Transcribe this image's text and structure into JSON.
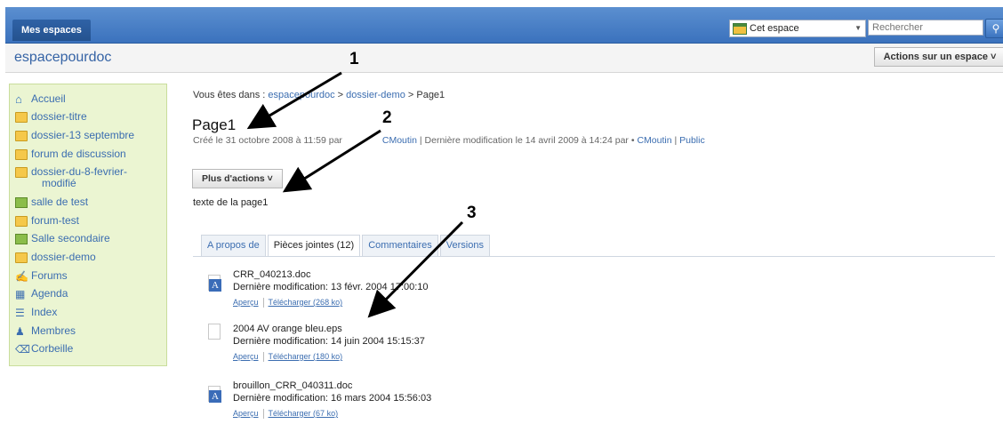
{
  "topbar": {
    "mes_espaces": "Mes espaces",
    "scope_label": "Cet espace",
    "search_placeholder": "Rechercher"
  },
  "space": {
    "title": "espacepourdoc",
    "actions_label": "Actions sur un espace ˅"
  },
  "sidebar": {
    "items": [
      {
        "label": "Accueil",
        "icon": "home-icon"
      },
      {
        "label": "dossier-titre",
        "icon": "folder-icon"
      },
      {
        "label": "dossier-13 septembre",
        "icon": "folder-icon"
      },
      {
        "label": "forum de discussion",
        "icon": "folder-icon"
      },
      {
        "label": "dossier-du-8-fevrier-",
        "label2": "modifié",
        "icon": "folder-icon"
      },
      {
        "label": "salle de test",
        "icon": "room-icon"
      },
      {
        "label": "forum-test",
        "icon": "folder-icon"
      },
      {
        "label": "Salle secondaire",
        "icon": "room-icon"
      },
      {
        "label": "dossier-demo",
        "icon": "folder-icon"
      },
      {
        "label": "Forums",
        "icon": "forum-icon"
      },
      {
        "label": "Agenda",
        "icon": "calendar-icon"
      },
      {
        "label": "Index",
        "icon": "index-icon"
      },
      {
        "label": "Membres",
        "icon": "members-icon"
      },
      {
        "label": "Corbeille",
        "icon": "trash-icon"
      }
    ]
  },
  "breadcrumb": {
    "prefix": "Vous êtes dans : ",
    "parts": [
      "espacepourdoc",
      "dossier-demo",
      "Page1"
    ],
    "sep": " > "
  },
  "page": {
    "title": "Page1",
    "meta_created": "Créé le 31 octobre 2008 à 11:59 par",
    "meta_author1": "CMoutin",
    "meta_modified": " | Dernière modification le 14 avril 2009 à 14:24 par • ",
    "meta_author2": "CMoutin",
    "meta_sep": " | ",
    "meta_public": "Public",
    "more_actions": "Plus d'actions ˅",
    "body": "texte de la page1"
  },
  "tabs": [
    {
      "label": "A propos de",
      "active": false
    },
    {
      "label": "Pièces jointes (12)",
      "active": true
    },
    {
      "label": "Commentaires",
      "active": false
    },
    {
      "label": "Versions",
      "active": false
    }
  ],
  "attachments": [
    {
      "name": "CRR_040213.doc",
      "modified": "Dernière modification: 13 févr. 2004 17:00:10",
      "preview": "Aperçu",
      "download": "Télécharger (268 ko)",
      "icon": "word-doc-icon"
    },
    {
      "name": "2004 AV orange bleu.eps",
      "modified": "Dernière modification: 14 juin 2004 15:15:37",
      "preview": "Aperçu",
      "download": "Télécharger (180 ko)",
      "icon": "file-icon"
    },
    {
      "name": "brouillon_CRR_040311.doc",
      "modified": "Dernière modification: 16 mars 2004 15:56:03",
      "preview": "Aperçu",
      "download": "Télécharger (67 ko)",
      "icon": "word-doc-icon"
    }
  ],
  "annotations": [
    "1",
    "2",
    "3"
  ]
}
